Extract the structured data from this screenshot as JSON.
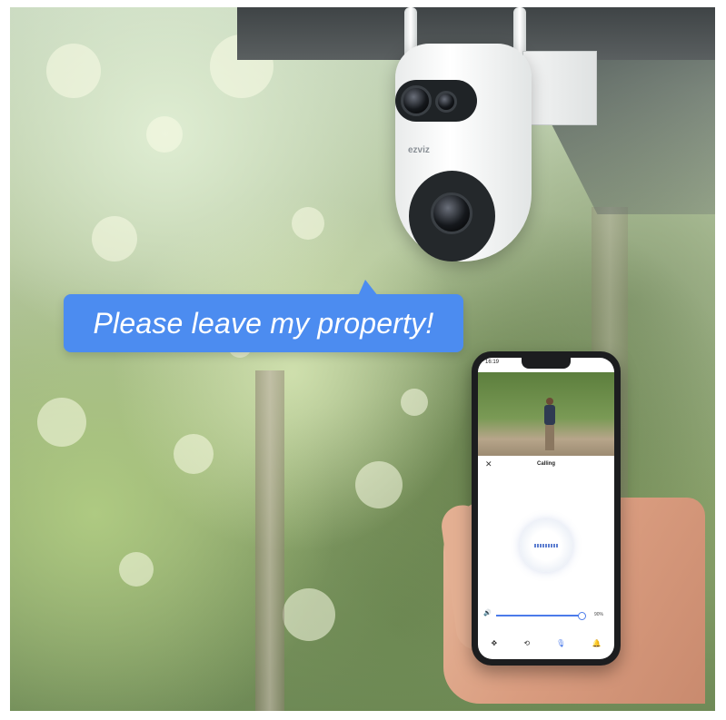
{
  "speech_bubble": {
    "text": "Please leave my property!"
  },
  "camera": {
    "brand": "ezviz"
  },
  "phone": {
    "status_time": "16:19",
    "screen_title": "Calling",
    "close_icon": "close-icon",
    "volume_percent": "90%",
    "volume_level": 0.9,
    "toolbar_icons": [
      "pan-tilt-icon",
      "loop-icon",
      "microphone-icon",
      "bell-icon"
    ]
  },
  "colors": {
    "bubble": "#4c8cf0",
    "accent": "#4b7bea"
  }
}
